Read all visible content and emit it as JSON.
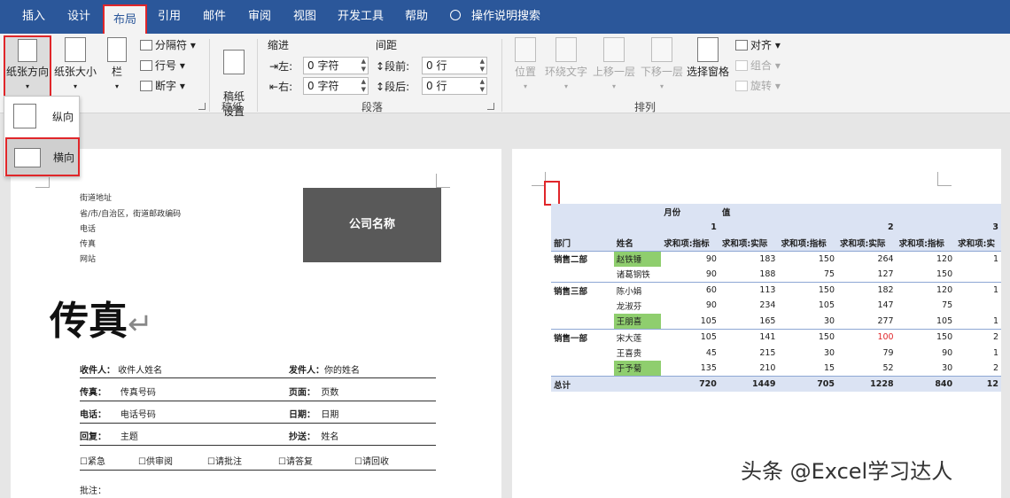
{
  "tabs": [
    "插入",
    "设计",
    "布局",
    "引用",
    "邮件",
    "审阅",
    "视图",
    "开发工具",
    "帮助"
  ],
  "search_tab": "操作说明搜索",
  "ribbon": {
    "orientation": "纸张方向",
    "size": "纸张大小",
    "columns": "栏",
    "breaks": "分隔符",
    "line_numbers": "行号",
    "hyphenation": "断字",
    "manuscript": "稿纸\n设置",
    "manuscript_group": "稿纸",
    "indent_label": "缩进",
    "spacing_label": "间距",
    "left_label": "左:",
    "right_label": "右:",
    "before_label": "段前:",
    "after_label": "段后:",
    "left_value": "0 字符",
    "right_value": "0 字符",
    "before_value": "0 行",
    "after_value": "0 行",
    "paragraph_group": "段落",
    "position": "位置",
    "wrap_text": "环绕文字",
    "bring_forward": "上移一层",
    "send_backward": "下移一层",
    "selection_pane": "选择窗格",
    "align": "对齐",
    "group": "组合",
    "rotate": "旋转",
    "arrange_group": "排列"
  },
  "dropdown": {
    "portrait": "纵向",
    "landscape": "横向"
  },
  "page1": {
    "address": [
      "街道地址",
      "省/市/自治区，街道邮政编码",
      "电话",
      "传真",
      "网站"
    ],
    "company": "公司名称",
    "title": "传真",
    "fields": {
      "to_label": "收件人：",
      "to_value": "收件人姓名",
      "from_label": "发件人：",
      "from_value": "你的姓名",
      "fax_label": "传真：",
      "fax_value": "传真号码",
      "pages_label": "页面：",
      "pages_value": "页数",
      "phone_label": "电话：",
      "phone_value": "电话号码",
      "date_label": "日期：",
      "date_value": "日期",
      "re_label": "回复：",
      "re_value": "主题",
      "cc_label": "抄送：",
      "cc_value": "姓名"
    },
    "checks": [
      "☐紧急",
      "☐供审阅",
      "☐请批注",
      "☐请答复",
      "☐请回收"
    ],
    "notes": "批注："
  },
  "pivot": {
    "row1": [
      "月份",
      "值"
    ],
    "months": [
      "1",
      "2",
      "3"
    ],
    "headers": [
      "部门",
      "姓名",
      "求和项:指标",
      "求和项:实际",
      "求和项:指标",
      "求和项:实际",
      "求和项:指标",
      "求和项:实"
    ],
    "rows": [
      {
        "dept": "销售二部",
        "name": "赵铁锤",
        "v": [
          "90",
          "183",
          "150",
          "264",
          "120",
          "1"
        ],
        "green": true
      },
      {
        "dept": "",
        "name": "诸葛钢铁",
        "v": [
          "90",
          "188",
          "75",
          "127",
          "150",
          ""
        ],
        "green": false
      },
      {
        "dept": "销售三部",
        "name": "陈小娟",
        "v": [
          "60",
          "113",
          "150",
          "182",
          "120",
          "1"
        ],
        "green": false
      },
      {
        "dept": "",
        "name": "龙淑芬",
        "v": [
          "90",
          "234",
          "105",
          "147",
          "75",
          ""
        ],
        "green": false
      },
      {
        "dept": "",
        "name": "王朋喜",
        "v": [
          "105",
          "165",
          "30",
          "277",
          "105",
          "1"
        ],
        "green": true
      },
      {
        "dept": "销售一部",
        "name": "宋大莲",
        "v": [
          "105",
          "141",
          "150",
          "100",
          "150",
          "2"
        ],
        "green": false
      },
      {
        "dept": "",
        "name": "王喜贵",
        "v": [
          "45",
          "215",
          "30",
          "79",
          "90",
          "1"
        ],
        "green": false
      },
      {
        "dept": "",
        "name": "于予菊",
        "v": [
          "135",
          "210",
          "15",
          "52",
          "30",
          "2"
        ],
        "green": true
      }
    ],
    "total_label": "总计",
    "totals": [
      "720",
      "1449",
      "705",
      "1228",
      "840",
      "12"
    ]
  },
  "watermark": "头条 @Excel学习达人"
}
